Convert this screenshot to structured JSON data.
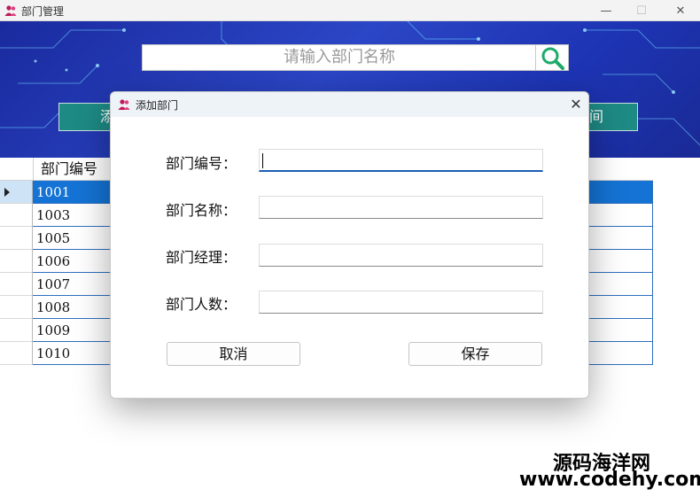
{
  "window": {
    "title": "部门管理",
    "minimize": "—",
    "maximize": "☐",
    "close": "✕"
  },
  "banner": {
    "search_placeholder": "请输入部门名称",
    "left_button_visible": "添",
    "right_button_visible": "间"
  },
  "grid": {
    "column_header": "部门编号",
    "rows": [
      "1001",
      "1003",
      "1005",
      "1006",
      "1007",
      "1008",
      "1009",
      "1010"
    ],
    "selected_row_index": 0
  },
  "dialog": {
    "title": "添加部门",
    "close": "✕",
    "fields": [
      {
        "label": "部门编号：",
        "value": ""
      },
      {
        "label": "部门名称：",
        "value": ""
      },
      {
        "label": "部门经理：",
        "value": ""
      },
      {
        "label": "部门人数：",
        "value": ""
      }
    ],
    "cancel_label": "取消",
    "save_label": "保存"
  },
  "watermark": {
    "line1": "源码海洋网",
    "line2": "www.codehy.com"
  },
  "colors": {
    "banner": "#2b46c6",
    "teal_button": "#1e8a84",
    "selection": "#1473d4",
    "grid_border": "#2e6fbf"
  },
  "icons": {
    "app": "users-icon",
    "search": "magnifier-icon"
  }
}
